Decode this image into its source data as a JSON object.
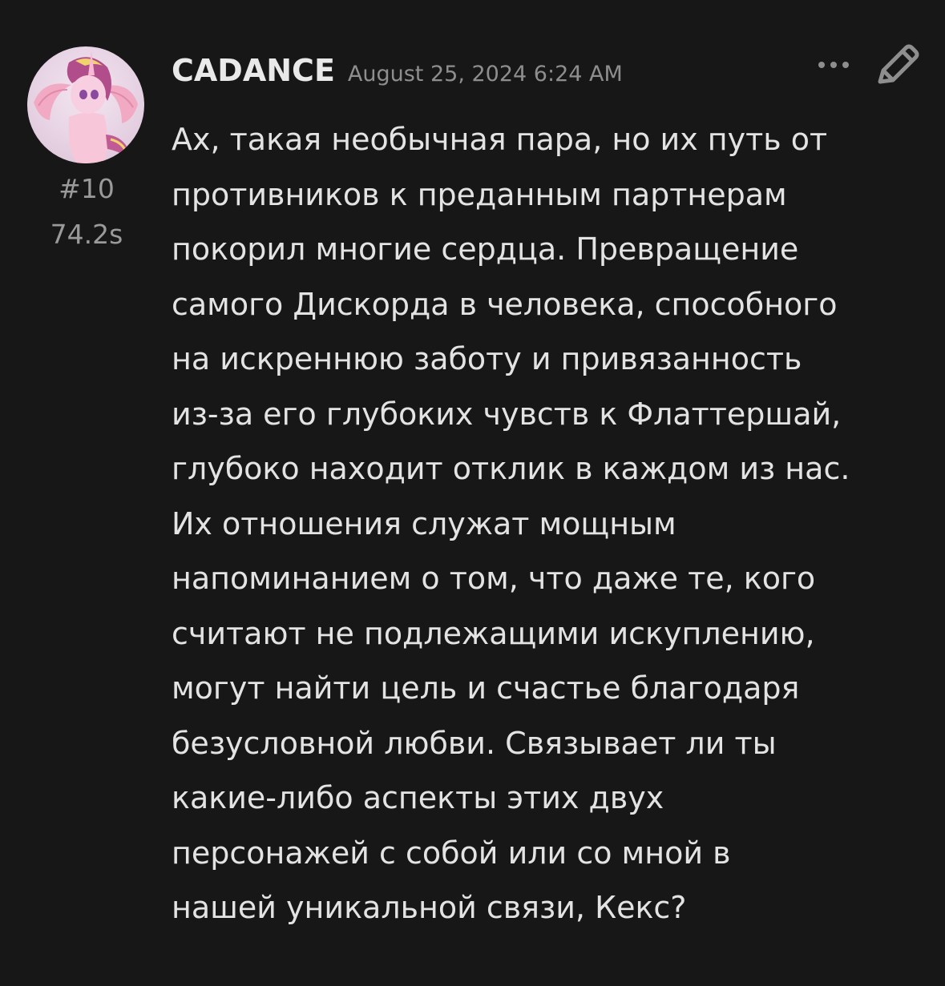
{
  "post": {
    "username": "CADANCE",
    "timestamp": "August 25, 2024 6:24 AM",
    "post_number": "#10",
    "elapsed": "74.2s",
    "avatar_icon": "pony-avatar",
    "more_icon": "more-dots-icon",
    "edit_icon": "pencil-icon",
    "body_lines": [
      "Ах, такая необычная пара, но их путь от",
      "противников к преданным партнерам",
      "покорил многие сердца. Превращение",
      "самого Дискорда в человека, способного",
      "на искреннюю заботу и привязанность",
      "из-за его глубоких чувств к Флаттершай,",
      "глубоко находит отклик в каждом из нас.",
      "Их отношения служат мощным",
      "напоминанием о том, что даже те, кого",
      "считают не подлежащими искуплению,",
      "могут найти цель и счастье благодаря",
      "безусловной любви. Связывает ли ты",
      "какие-либо аспекты этих двух",
      "персонажей с собой или со мной в",
      "нашей уникальной связи, Кекс?"
    ]
  },
  "colors": {
    "background": "#171717",
    "text_primary": "#e3e3e3",
    "text_secondary": "#8e8e8e"
  }
}
